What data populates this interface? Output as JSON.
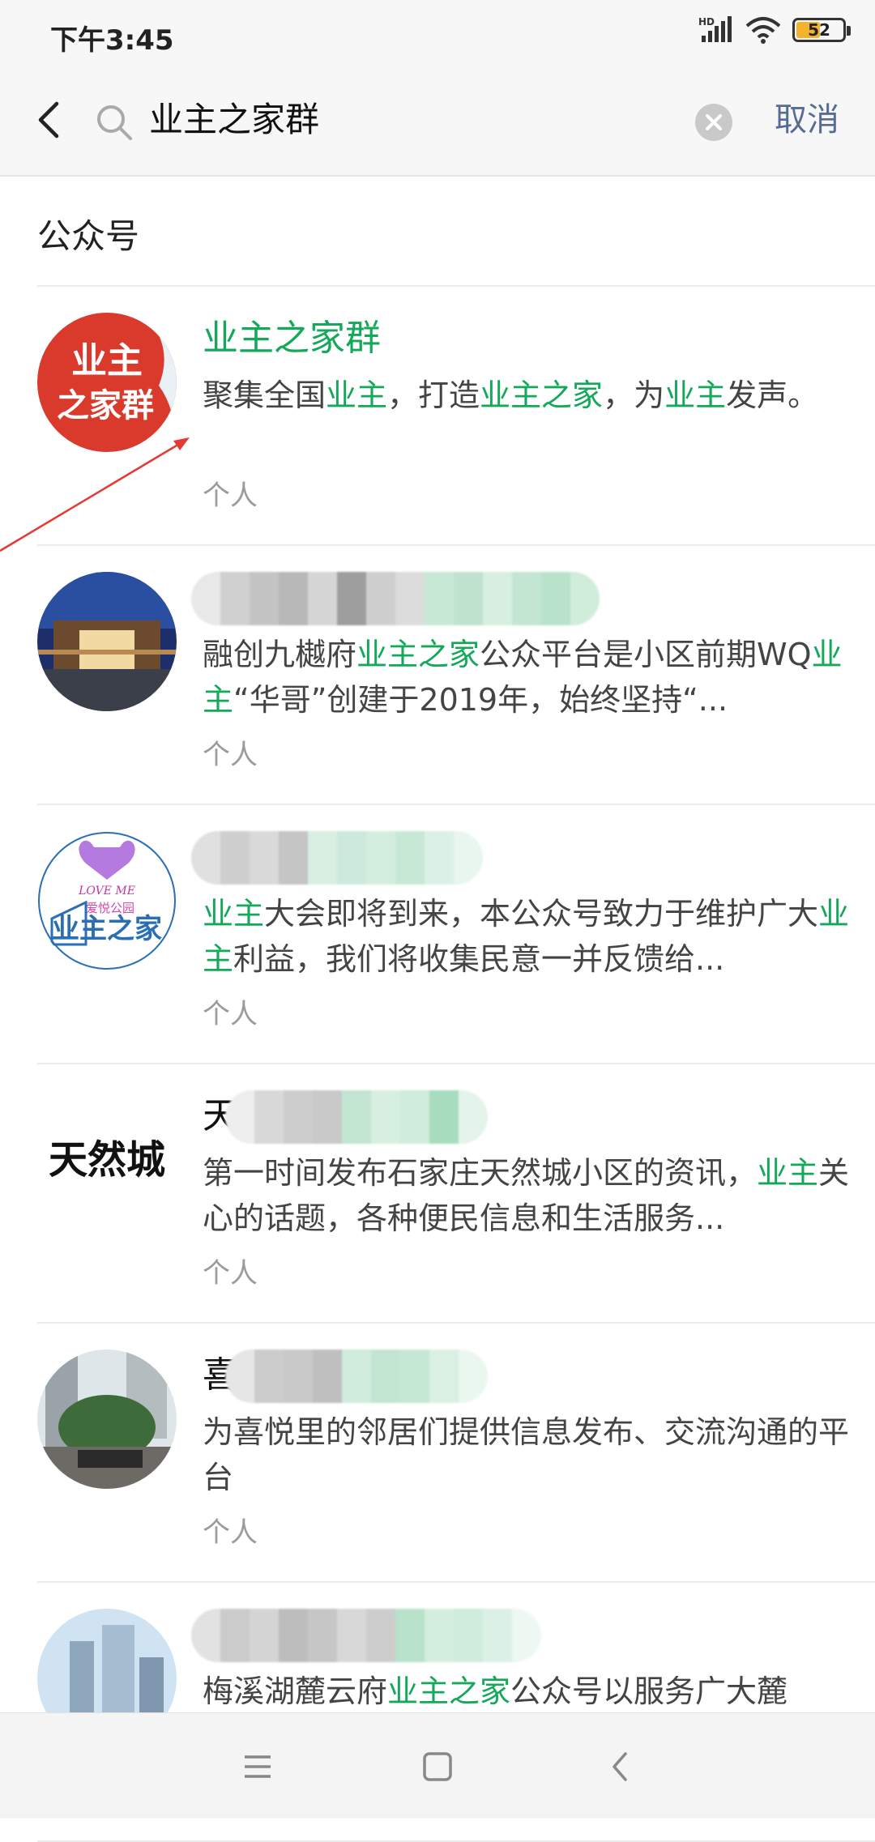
{
  "status_bar": {
    "time": "下午3:45",
    "hd_label": "HD",
    "battery": "52",
    "battery_level_percent": 52
  },
  "search": {
    "query": "业主之家群",
    "cancel_label": "取消"
  },
  "section": {
    "title": "公众号"
  },
  "results": [
    {
      "name_parts": [
        {
          "t": "业主之家群",
          "hl": true
        }
      ],
      "desc_parts": [
        {
          "t": "聚集全国",
          "hl": false
        },
        {
          "t": "业主",
          "hl": true
        },
        {
          "t": "，打造",
          "hl": false
        },
        {
          "t": "业主之家",
          "hl": true
        },
        {
          "t": "，为",
          "hl": false
        },
        {
          "t": "业主",
          "hl": true
        },
        {
          "t": "发声。",
          "hl": false
        }
      ],
      "type": "个人",
      "avatar_text": [
        "业主",
        "之家群"
      ]
    },
    {
      "name_parts": [],
      "desc_parts": [
        {
          "t": "融创九樾府",
          "hl": false
        },
        {
          "t": "业主之家",
          "hl": true
        },
        {
          "t": "公众平台是小区前期WQ",
          "hl": false
        },
        {
          "t": "业主",
          "hl": true
        },
        {
          "t": "“华哥”创建于2019年，始终坚持“...",
          "hl": false
        }
      ],
      "type": "个人"
    },
    {
      "name_parts": [],
      "desc_parts": [
        {
          "t": "业主",
          "hl": true
        },
        {
          "t": "大会即将到来，本公众号致力于维护广大",
          "hl": false
        },
        {
          "t": "业主",
          "hl": true
        },
        {
          "t": "利益，我们将收集民意一并反馈给...",
          "hl": false
        }
      ],
      "type": "个人",
      "avatar_text": [
        "LOVE ME",
        "爱悦公园",
        "业主之家"
      ]
    },
    {
      "name_parts": [
        {
          "t": "天然",
          "hl": false
        }
      ],
      "desc_parts": [
        {
          "t": "第一时间发布石家庄天然城小区的资讯，",
          "hl": false
        },
        {
          "t": "业主",
          "hl": true
        },
        {
          "t": "关心的话题，各种便民信息和生活服务...",
          "hl": false
        }
      ],
      "type": "个人",
      "avatar_text": [
        "天然城"
      ]
    },
    {
      "name_parts": [
        {
          "t": "喜悦",
          "hl": false
        }
      ],
      "desc_parts": [
        {
          "t": "为喜悦里的邻居们提供信息发布、交流沟通的平台",
          "hl": false
        }
      ],
      "type": "个人"
    },
    {
      "name_parts": [
        {
          "t": "梅",
          "hl": false
        }
      ],
      "desc_parts": [
        {
          "t": "梅溪湖麓云府",
          "hl": false
        },
        {
          "t": "业主之家",
          "hl": true
        },
        {
          "t": "公众号以服务广大麓",
          "hl": false
        }
      ],
      "type": ""
    }
  ],
  "colors": {
    "highlight": "#13a85a",
    "link": "#576b95",
    "annotation_arrow": "#e53935"
  }
}
